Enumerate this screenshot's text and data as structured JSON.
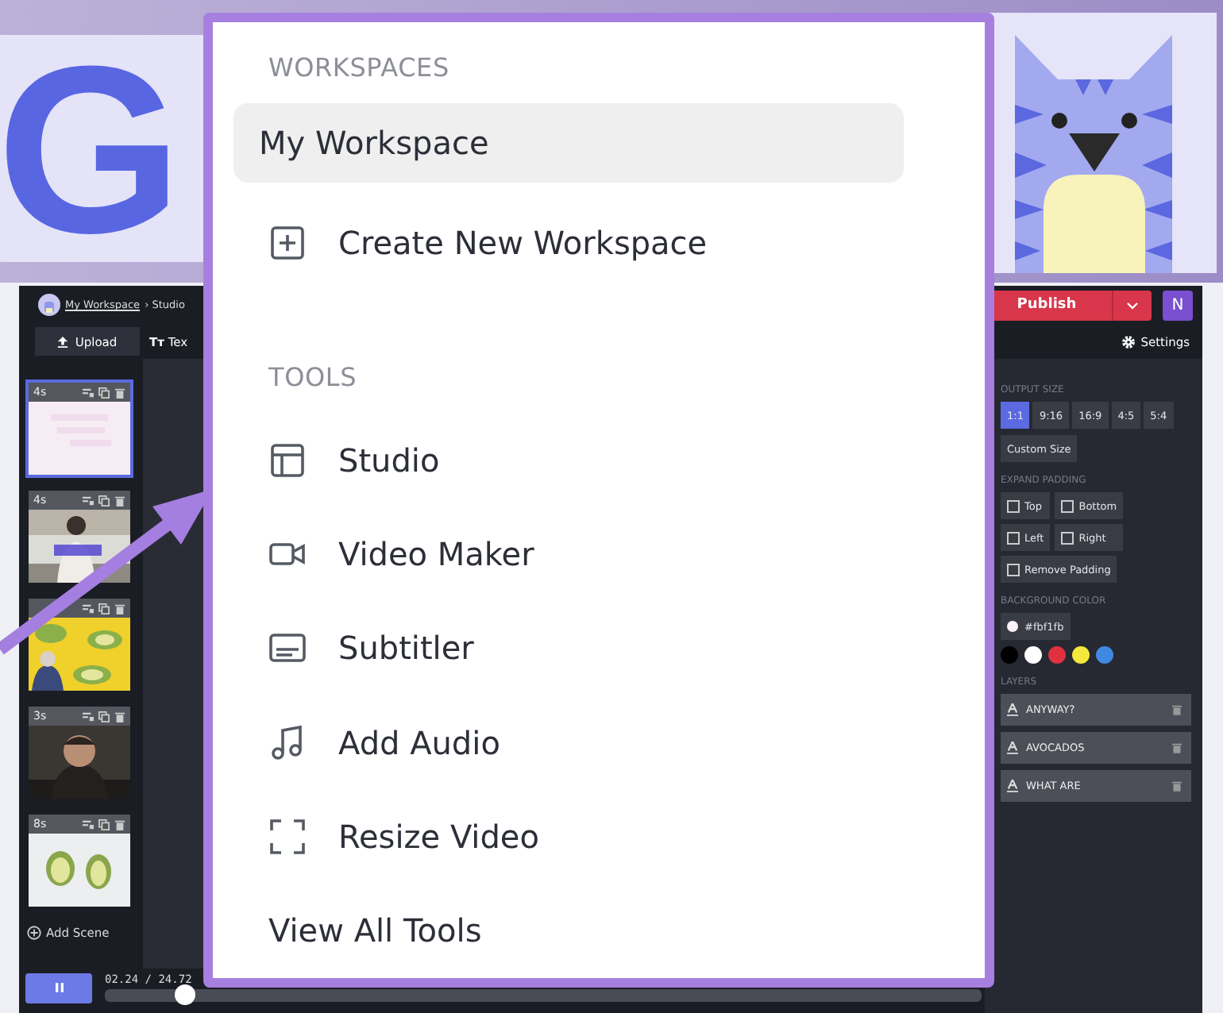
{
  "logo_tile": {
    "letter": "G"
  },
  "editor": {
    "breadcrumb": {
      "link": "My Workspace",
      "current": "› Studio"
    },
    "publish": {
      "label": "Publish"
    },
    "user_avatar": {
      "initial": "N"
    },
    "toolbar": {
      "upload": "Upload",
      "text_icon": "Tт",
      "text_tool": "Tex",
      "settings": "Settings"
    },
    "scenes": [
      {
        "duration": "4s",
        "selected": true
      },
      {
        "duration": "4s",
        "selected": false
      },
      {
        "selected": false
      },
      {
        "duration": "3s",
        "selected": false
      },
      {
        "duration": "8s",
        "selected": false
      }
    ],
    "add_scene": "Add Scene",
    "player": {
      "time": "02.24 / 24.72",
      "level": 0.09
    },
    "settings_panel": {
      "output_size": {
        "heading": "OUTPUT SIZE",
        "options": [
          {
            "label": "1:1",
            "selected": true
          },
          {
            "label": "9:16",
            "selected": false
          },
          {
            "label": "16:9",
            "selected": false
          },
          {
            "label": "4:5",
            "selected": false
          },
          {
            "label": "5:4",
            "selected": false
          }
        ],
        "custom": "Custom Size"
      },
      "expand_padding": {
        "heading": "EXPAND PADDING",
        "options": [
          {
            "label": "Top",
            "checked": false
          },
          {
            "label": "Bottom",
            "checked": false
          },
          {
            "label": "Left",
            "checked": false
          },
          {
            "label": "Right",
            "checked": false
          },
          {
            "label": "Remove Padding",
            "checked": false
          }
        ]
      },
      "background_color": {
        "heading": "BACKGROUND COLOR",
        "value": "#fbf1fb",
        "presets": [
          {
            "color": "#000000"
          },
          {
            "color": "#ffffff"
          },
          {
            "color": "#e0313f"
          },
          {
            "color": "#f4e93a"
          },
          {
            "color": "#3f8ae0"
          }
        ]
      },
      "layers": {
        "heading": "LAYERS",
        "items": [
          {
            "label": "ANYWAY?"
          },
          {
            "label": "AVOCADOS"
          },
          {
            "label": "WHAT ARE"
          }
        ]
      }
    }
  },
  "menu": {
    "workspaces_heading": "WORKSPACES",
    "workspaces": [
      {
        "label": "My Workspace",
        "selected": true
      }
    ],
    "create_workspace": "Create New Workspace",
    "tools_heading": "TOOLS",
    "tools": [
      {
        "label": "Studio"
      },
      {
        "label": "Video Maker"
      },
      {
        "label": "Subtitler"
      },
      {
        "label": "Add Audio"
      },
      {
        "label": "Resize Video"
      }
    ],
    "view_all": "View All Tools"
  }
}
